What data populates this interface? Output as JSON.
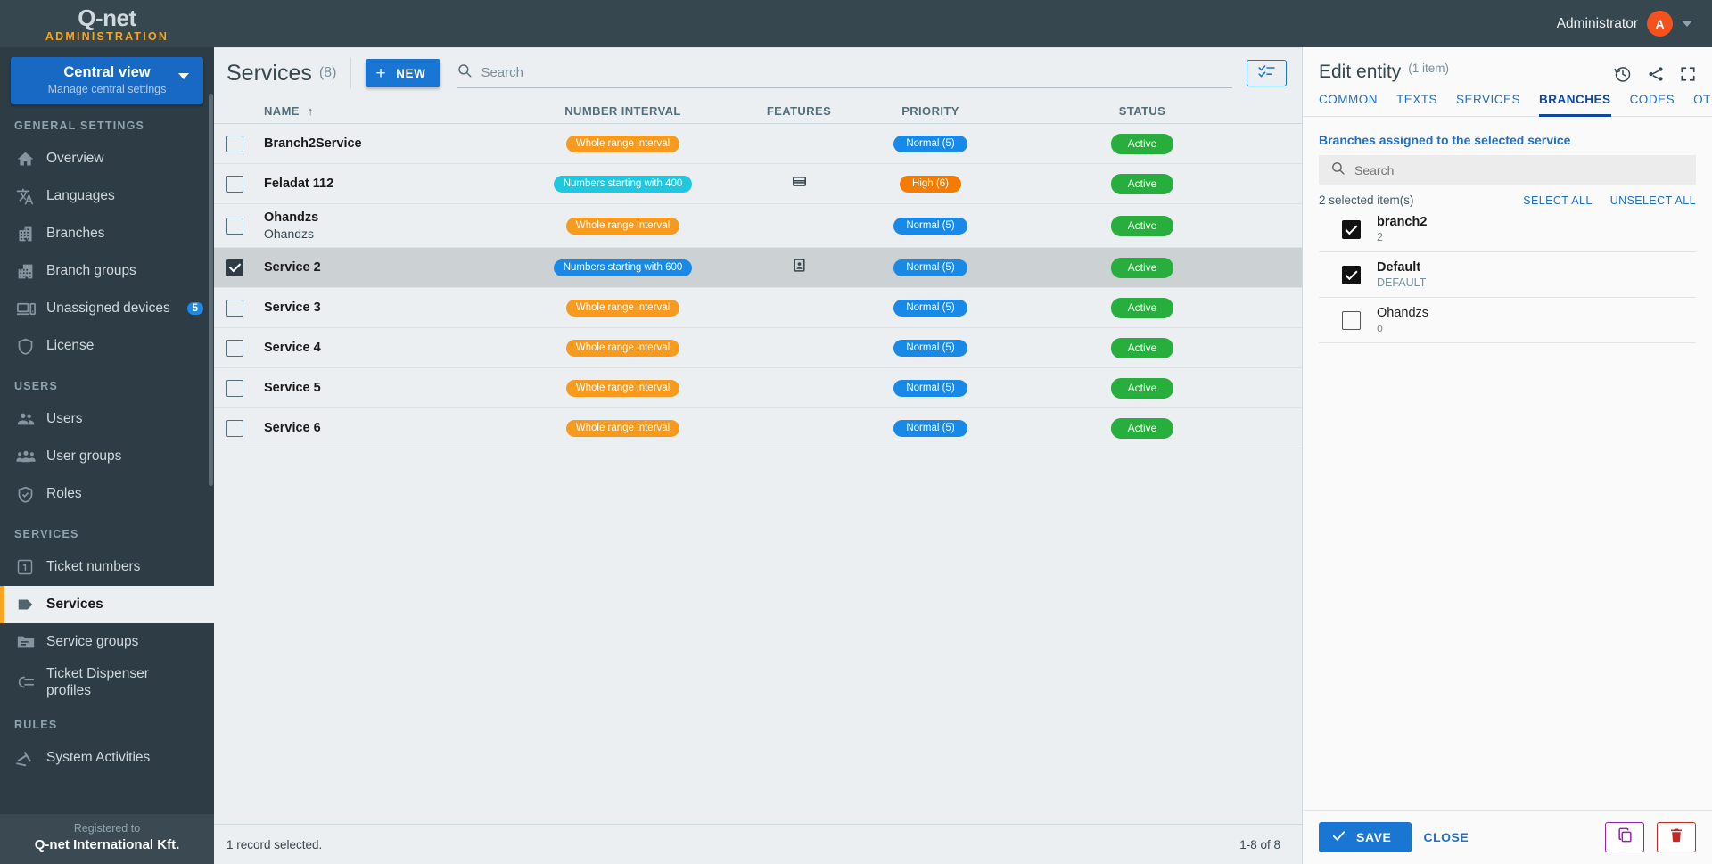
{
  "topbar": {
    "logo": "Q-net",
    "logo_sub": "ADMINISTRATION",
    "user_name": "Administrator",
    "avatar_initial": "A"
  },
  "sidebar": {
    "view_button": {
      "title": "Central view",
      "subtitle": "Manage central settings"
    },
    "sections": [
      {
        "label": "GENERAL SETTINGS",
        "items": [
          {
            "label": "Overview",
            "icon": "home-icon",
            "badge": null,
            "active": false
          },
          {
            "label": "Languages",
            "icon": "translate-icon",
            "badge": null,
            "active": false
          },
          {
            "label": "Branches",
            "icon": "building-icon",
            "badge": null,
            "active": false
          },
          {
            "label": "Branch groups",
            "icon": "buildings-icon",
            "badge": null,
            "active": false
          },
          {
            "label": "Unassigned devices",
            "icon": "devices-icon",
            "badge": "5",
            "active": false
          },
          {
            "label": "License",
            "icon": "shield-icon",
            "badge": null,
            "active": false
          }
        ]
      },
      {
        "label": "USERS",
        "items": [
          {
            "label": "Users",
            "icon": "users-icon",
            "badge": null,
            "active": false
          },
          {
            "label": "User groups",
            "icon": "user-group-icon",
            "badge": null,
            "active": false
          },
          {
            "label": "Roles",
            "icon": "shield-check-icon",
            "badge": null,
            "active": false
          }
        ]
      },
      {
        "label": "SERVICES",
        "items": [
          {
            "label": "Ticket numbers",
            "icon": "number-one-icon",
            "badge": null,
            "active": false
          },
          {
            "label": "Services",
            "icon": "tag-icon",
            "badge": null,
            "active": true
          },
          {
            "label": "Service groups",
            "icon": "folder-icon",
            "badge": null,
            "active": false
          },
          {
            "label": "Ticket Dispenser profiles",
            "icon": "dispenser-icon",
            "badge": null,
            "active": false
          }
        ]
      },
      {
        "label": "RULES",
        "items": [
          {
            "label": "System Activities",
            "icon": "gavel-icon",
            "badge": null,
            "active": false
          }
        ]
      }
    ],
    "footer": {
      "registered_to": "Registered to",
      "company": "Q-net International Kft."
    }
  },
  "main": {
    "title": "Services",
    "count": "(8)",
    "new_button": "NEW",
    "new_button_plus": "+",
    "search_placeholder": "Search",
    "search_value": "",
    "columns": [
      "NAME",
      "NUMBER INTERVAL",
      "FEATURES",
      "PRIORITY",
      "STATUS"
    ],
    "sort_indicator": "↑",
    "rows": [
      {
        "name": "Branch2Service",
        "sub": "",
        "interval": "Whole range interval",
        "interval_color": "orange",
        "feature_icon": "",
        "priority": "Normal (5)",
        "priority_color": "prio-normal",
        "status": "Active",
        "checked": false,
        "selected": false
      },
      {
        "name": "Feladat 112",
        "sub": "",
        "interval": "Numbers starting with 400",
        "interval_color": "cyan",
        "feature_icon": "card-icon",
        "priority": "High (6)",
        "priority_color": "prio-high",
        "status": "Active",
        "checked": false,
        "selected": false
      },
      {
        "name": "Ohandzs",
        "sub": "Ohandzs",
        "interval": "Whole range interval",
        "interval_color": "orange",
        "feature_icon": "",
        "priority": "Normal (5)",
        "priority_color": "prio-normal",
        "status": "Active",
        "checked": false,
        "selected": false
      },
      {
        "name": "Service 2",
        "sub": "",
        "interval": "Numbers starting with 600",
        "interval_color": "blue",
        "feature_icon": "person-card-icon",
        "priority": "Normal (5)",
        "priority_color": "prio-normal",
        "status": "Active",
        "checked": true,
        "selected": true
      },
      {
        "name": "Service 3",
        "sub": "",
        "interval": "Whole range interval",
        "interval_color": "orange",
        "feature_icon": "",
        "priority": "Normal (5)",
        "priority_color": "prio-normal",
        "status": "Active",
        "checked": false,
        "selected": false
      },
      {
        "name": "Service 4",
        "sub": "",
        "interval": "Whole range interval",
        "interval_color": "orange",
        "feature_icon": "",
        "priority": "Normal (5)",
        "priority_color": "prio-normal",
        "status": "Active",
        "checked": false,
        "selected": false
      },
      {
        "name": "Service 5",
        "sub": "",
        "interval": "Whole range interval",
        "interval_color": "orange",
        "feature_icon": "",
        "priority": "Normal (5)",
        "priority_color": "prio-normal",
        "status": "Active",
        "checked": false,
        "selected": false
      },
      {
        "name": "Service 6",
        "sub": "",
        "interval": "Whole range interval",
        "interval_color": "orange",
        "feature_icon": "",
        "priority": "Normal (5)",
        "priority_color": "prio-normal",
        "status": "Active",
        "checked": false,
        "selected": false
      }
    ],
    "footer_status": "1 record selected.",
    "footer_pager": "1-8 of 8"
  },
  "rpanel": {
    "title": "Edit entity",
    "item_count": "(1 item)",
    "tabs": [
      {
        "label": "COMMON",
        "active": false
      },
      {
        "label": "TEXTS",
        "active": false
      },
      {
        "label": "SERVICES",
        "active": false
      },
      {
        "label": "BRANCHES",
        "active": true
      },
      {
        "label": "CODES",
        "active": false
      },
      {
        "label": "OTHERS",
        "active": false
      }
    ],
    "section_label": "Branches assigned to the selected service",
    "search_placeholder": "Search",
    "search_value": "",
    "selected_count": "2 selected item(s)",
    "select_all": "SELECT ALL",
    "unselect_all": "UNSELECT ALL",
    "branches": [
      {
        "name": "branch2",
        "sub": "2",
        "checked": true
      },
      {
        "name": "Default",
        "sub": "DEFAULT",
        "checked": true
      },
      {
        "name": "Ohandzs",
        "sub": "o",
        "checked": false
      }
    ],
    "save_label": "SAVE",
    "close_label": "CLOSE"
  },
  "colors": {
    "accent_blue": "#1976d2",
    "sidebar_bg": "#2e3d45",
    "topbar_bg": "#37474f",
    "active_marker": "#f5a623",
    "status_green": "#27ae3c",
    "priority_high": "#f57c00",
    "delete_red": "#c62828",
    "copy_purple": "#8e24aa"
  }
}
